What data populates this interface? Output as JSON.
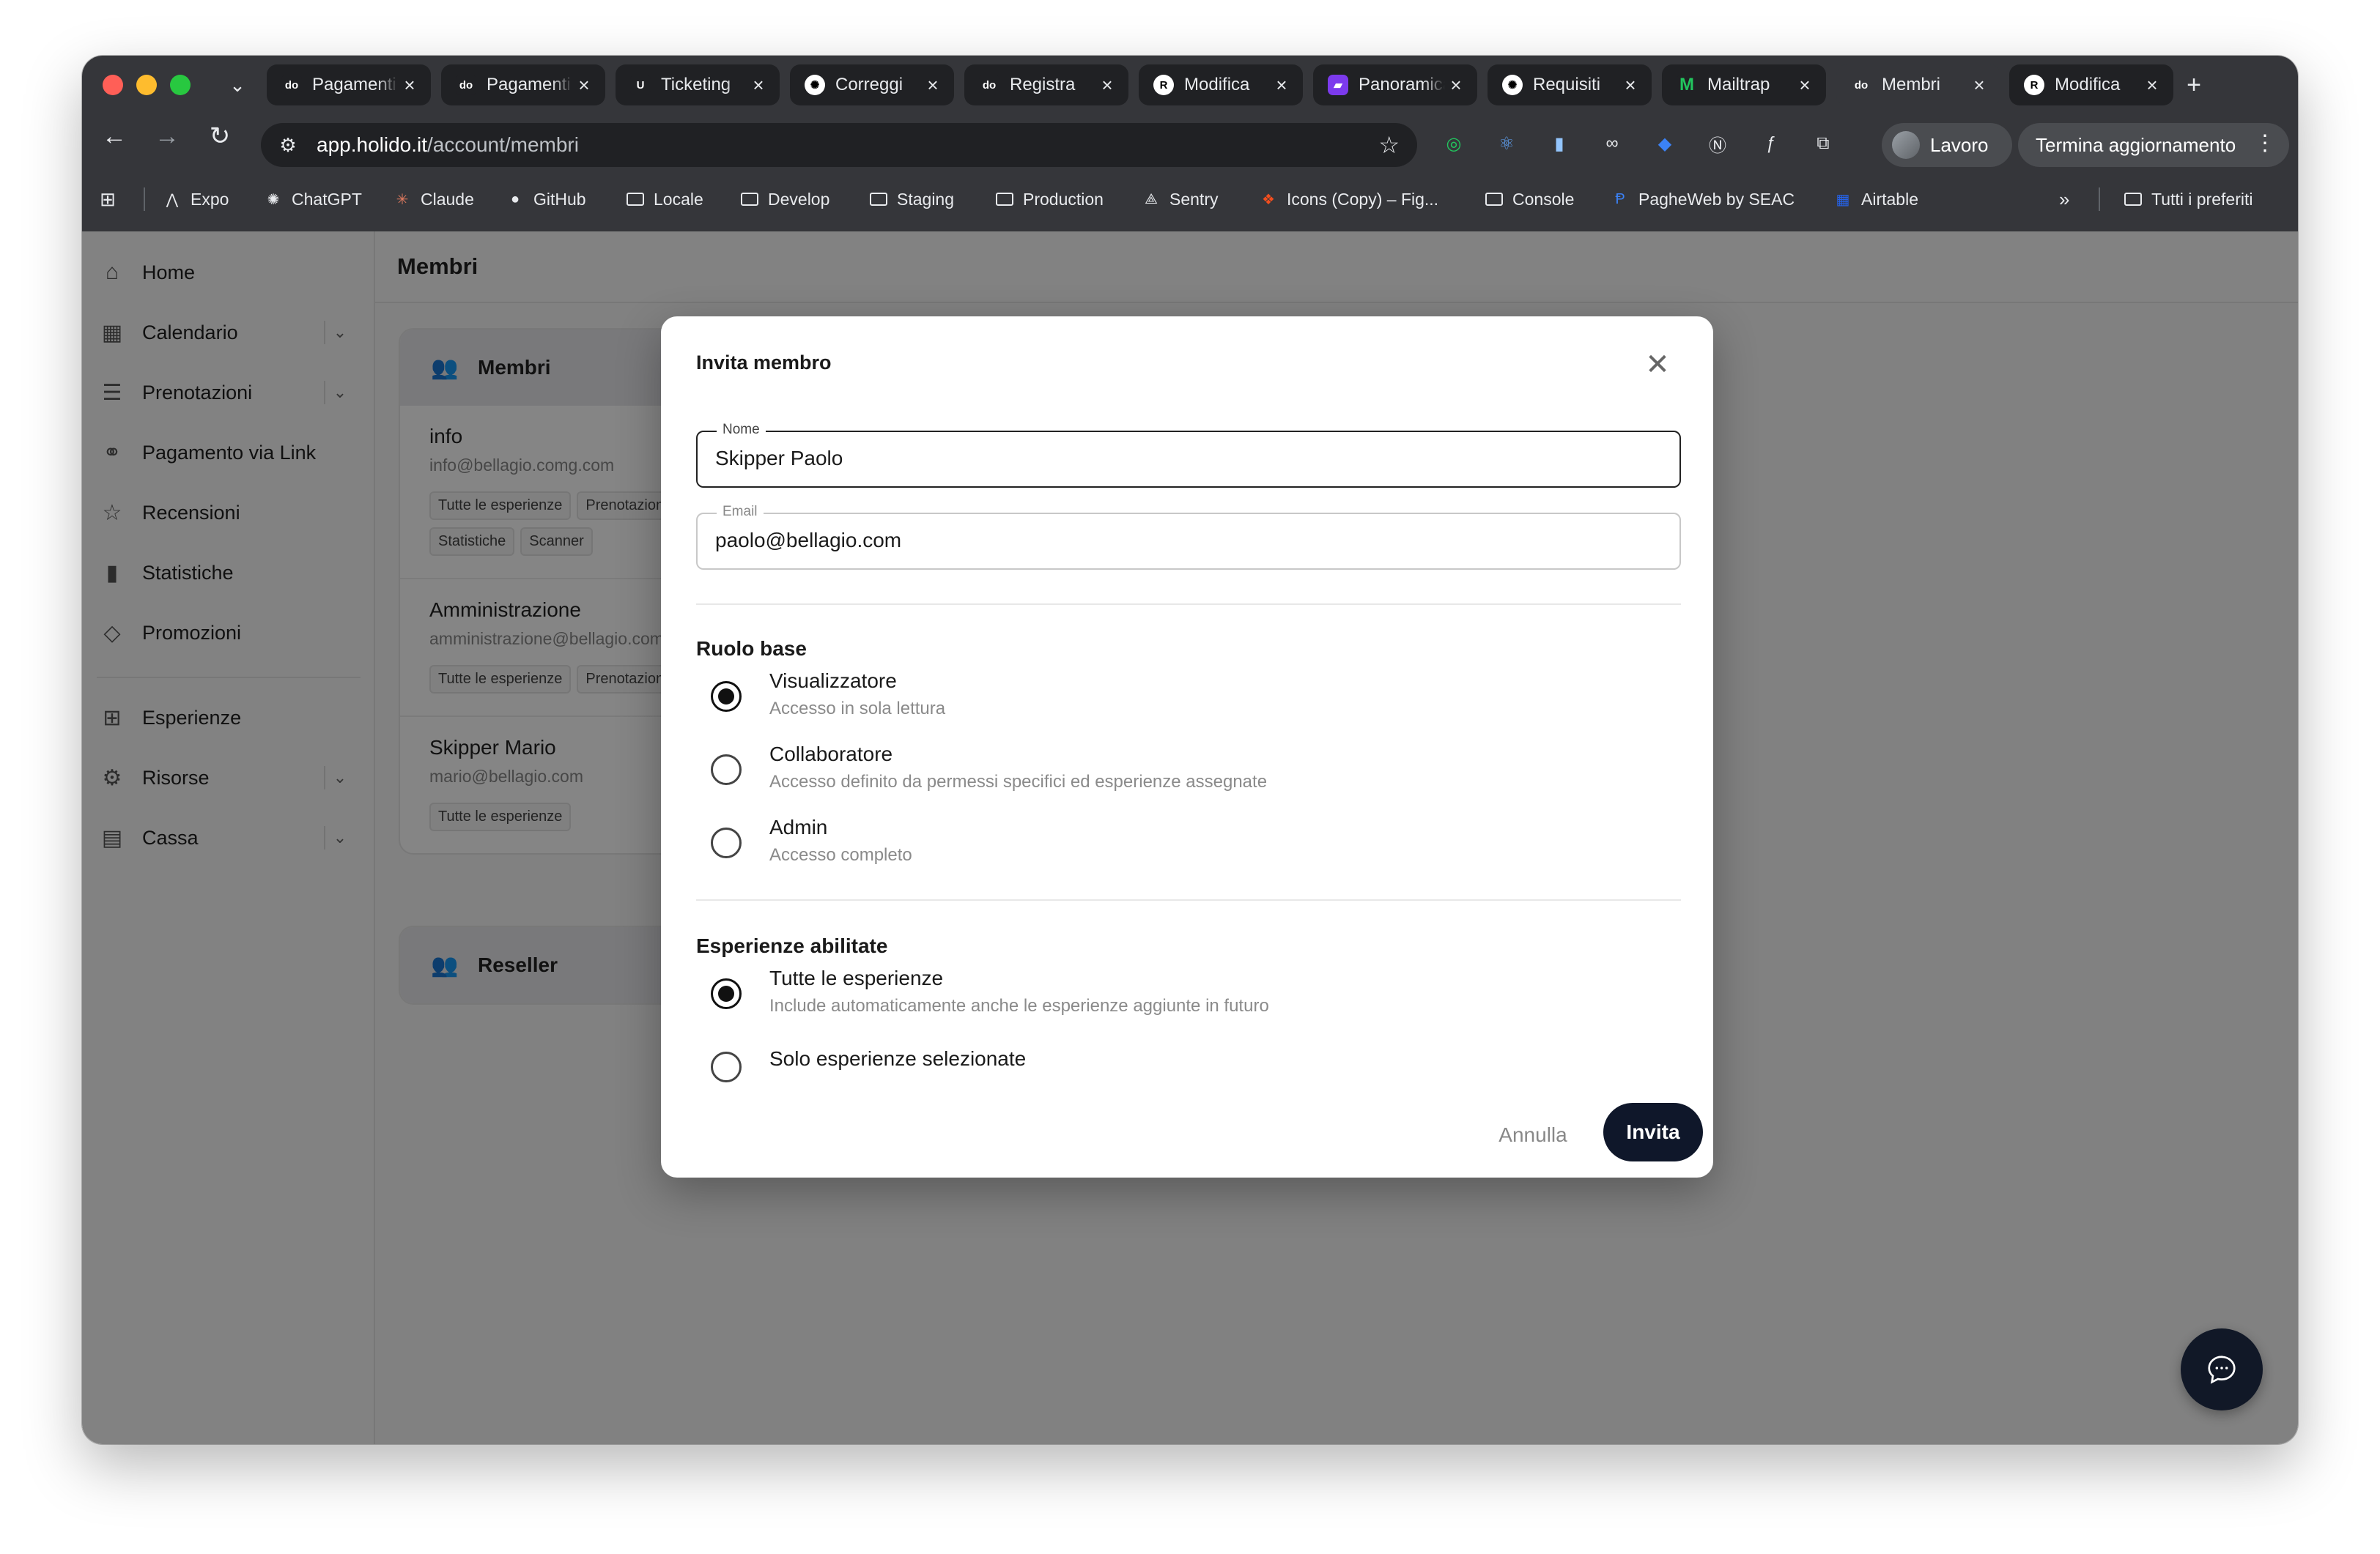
{
  "browser": {
    "tabs": [
      {
        "title": "Pagamenti",
        "favicon": "do"
      },
      {
        "title": "Pagamenti",
        "favicon": "do"
      },
      {
        "title": "Ticketing",
        "favicon": "U"
      },
      {
        "title": "Correggi",
        "favicon": "openai"
      },
      {
        "title": "Registra",
        "favicon": "do"
      },
      {
        "title": "Modifica",
        "favicon": "R"
      },
      {
        "title": "Panoramica",
        "favicon": "panel"
      },
      {
        "title": "Requisiti",
        "favicon": "openai"
      },
      {
        "title": "Mailtrap",
        "favicon": "M"
      },
      {
        "title": "Membri",
        "favicon": "do",
        "active": true
      },
      {
        "title": "Modifica",
        "favicon": "R"
      }
    ],
    "tab_close_glyph": "×",
    "url_host": "app.holido.it",
    "url_path": "/account/membri",
    "profile_name": "Lavoro",
    "update_button": "Termina aggiornamento",
    "bookmarks": [
      {
        "label": "Expo",
        "icon": "expo-icon"
      },
      {
        "label": "ChatGPT",
        "icon": "openai-icon"
      },
      {
        "label": "Claude",
        "icon": "claude-icon"
      },
      {
        "label": "GitHub",
        "icon": "github-icon"
      },
      {
        "label": "Locale",
        "icon": "folder-icon"
      },
      {
        "label": "Develop",
        "icon": "folder-icon"
      },
      {
        "label": "Staging",
        "icon": "folder-icon"
      },
      {
        "label": "Production",
        "icon": "folder-icon"
      },
      {
        "label": "Sentry",
        "icon": "sentry-icon"
      },
      {
        "label": "Icons (Copy) – Fig...",
        "icon": "figma-icon"
      },
      {
        "label": "Console",
        "icon": "folder-icon"
      },
      {
        "label": "PagheWeb by SEAC",
        "icon": "paghe-icon"
      },
      {
        "label": "Airtable",
        "icon": "airtable-icon"
      }
    ],
    "all_bookmarks": "Tutti i preferiti"
  },
  "sidebar": {
    "items": [
      {
        "label": "Home",
        "icon": "home-icon",
        "has_chevron": false
      },
      {
        "label": "Calendario",
        "icon": "calendar-icon",
        "has_chevron": true
      },
      {
        "label": "Prenotazioni",
        "icon": "bookings-icon",
        "has_chevron": true
      },
      {
        "label": "Pagamento via Link",
        "icon": "link-icon",
        "has_chevron": false
      },
      {
        "label": "Recensioni",
        "icon": "star-icon",
        "has_chevron": false
      },
      {
        "label": "Statistiche",
        "icon": "chart-icon",
        "has_chevron": false
      },
      {
        "label": "Promozioni",
        "icon": "tag-icon",
        "has_chevron": false
      },
      {
        "label": "Esperienze",
        "icon": "grid-icon",
        "has_chevron": false
      },
      {
        "label": "Risorse",
        "icon": "gear-icon",
        "has_chevron": true
      },
      {
        "label": "Cassa",
        "icon": "register-icon",
        "has_chevron": true
      }
    ]
  },
  "page": {
    "title": "Membri",
    "members_card_title": "Membri",
    "members": [
      {
        "name": "info",
        "email": "info@bellagio.comg.com",
        "chips": [
          "Tutte le esperienze",
          "Prenotazioni",
          "Statistiche",
          "Scanner"
        ]
      },
      {
        "name": "Amministrazione",
        "email": "amministrazione@bellagio.com",
        "chips": [
          "Tutte le esperienze",
          "Prenotazioni"
        ]
      },
      {
        "name": "Skipper Mario",
        "email": "mario@bellagio.com",
        "chips": [
          "Tutte le esperienze"
        ]
      }
    ],
    "reseller_card_title": "Reseller"
  },
  "modal": {
    "title": "Invita membro",
    "name_label": "Nome",
    "name_value": "Skipper Paolo",
    "email_label": "Email",
    "email_value": "paolo@bellagio.com",
    "role_section": "Ruolo base",
    "roles": [
      {
        "label": "Visualizzatore",
        "desc": "Accesso in sola lettura",
        "checked": true
      },
      {
        "label": "Collaboratore",
        "desc": "Accesso definito da permessi specifici ed esperienze assegnate",
        "checked": false
      },
      {
        "label": "Admin",
        "desc": "Accesso completo",
        "checked": false
      }
    ],
    "experiences_section": "Esperienze abilitate",
    "experiences": [
      {
        "label": "Tutte le esperienze",
        "desc": "Include automaticamente anche le esperienze aggiunte in futuro",
        "checked": true
      },
      {
        "label": "Solo esperienze selezionate",
        "desc": "",
        "checked": false
      }
    ],
    "cancel_label": "Annulla",
    "invite_label": "Invita"
  },
  "colors": {
    "primary_button": "#0f172a",
    "overlay": "rgba(0,0,0,0.48)",
    "chrome": "#35363a"
  }
}
